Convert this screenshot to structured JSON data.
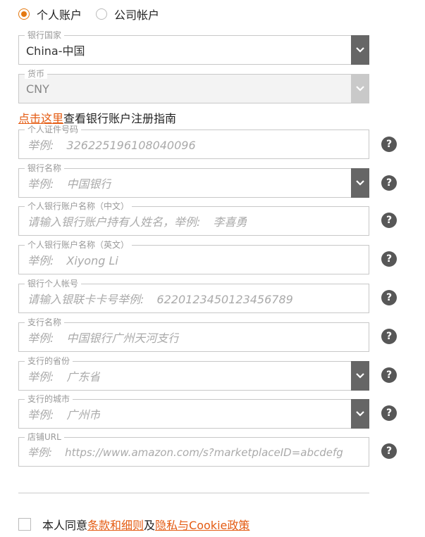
{
  "account_type": {
    "personal": "个人账户",
    "company": "公司帐户",
    "selected": "personal"
  },
  "fields": {
    "bank_country": {
      "label": "银行国家",
      "value": "China-中国"
    },
    "currency": {
      "label": "货币",
      "value": "CNY"
    },
    "id_number": {
      "label": "个人证件号码",
      "placeholder_key": "举例:",
      "placeholder": "326225196108040096"
    },
    "bank_name": {
      "label": "银行名称",
      "placeholder_key": "举例:",
      "placeholder": "中国银行"
    },
    "holder_cn": {
      "label": "个人银行账户名称（中文）",
      "placeholder_key": "请输入银行账户持有人姓名，举例:",
      "placeholder": "李喜勇"
    },
    "holder_en": {
      "label": "个人银行账户名称（英文）",
      "placeholder_key": "举例:",
      "placeholder": "Xiyong Li"
    },
    "account_no": {
      "label": "银行个人帐号",
      "placeholder_key": "请输入银联卡卡号举例:",
      "placeholder": "6220123450123456789"
    },
    "branch": {
      "label": "支行名称",
      "placeholder_key": "举例:",
      "placeholder": "中国银行广州天河支行"
    },
    "branch_province": {
      "label": "支行的省份",
      "placeholder_key": "举例:",
      "placeholder": "广东省"
    },
    "branch_city": {
      "label": "支行的城市",
      "placeholder_key": "举例:",
      "placeholder": "广州市"
    },
    "store_url": {
      "label": "店铺URL",
      "placeholder_key": "举例:",
      "placeholder": "https://www.amazon.com/s?marketplaceID=abcdefg"
    }
  },
  "guide": {
    "link": "点击这里",
    "text": "查看银行账户注册指南"
  },
  "help_glyph": "?",
  "agree": {
    "prefix": "本人同意",
    "terms": "条款和细则",
    "and": "及",
    "privacy": "隐私与Cookie政策"
  },
  "colors": {
    "accent": "#e47911",
    "link": "#e45b12",
    "select_arrow": "#666666"
  },
  "icons": {
    "select": "chevron-down-icon",
    "help": "help-icon"
  }
}
